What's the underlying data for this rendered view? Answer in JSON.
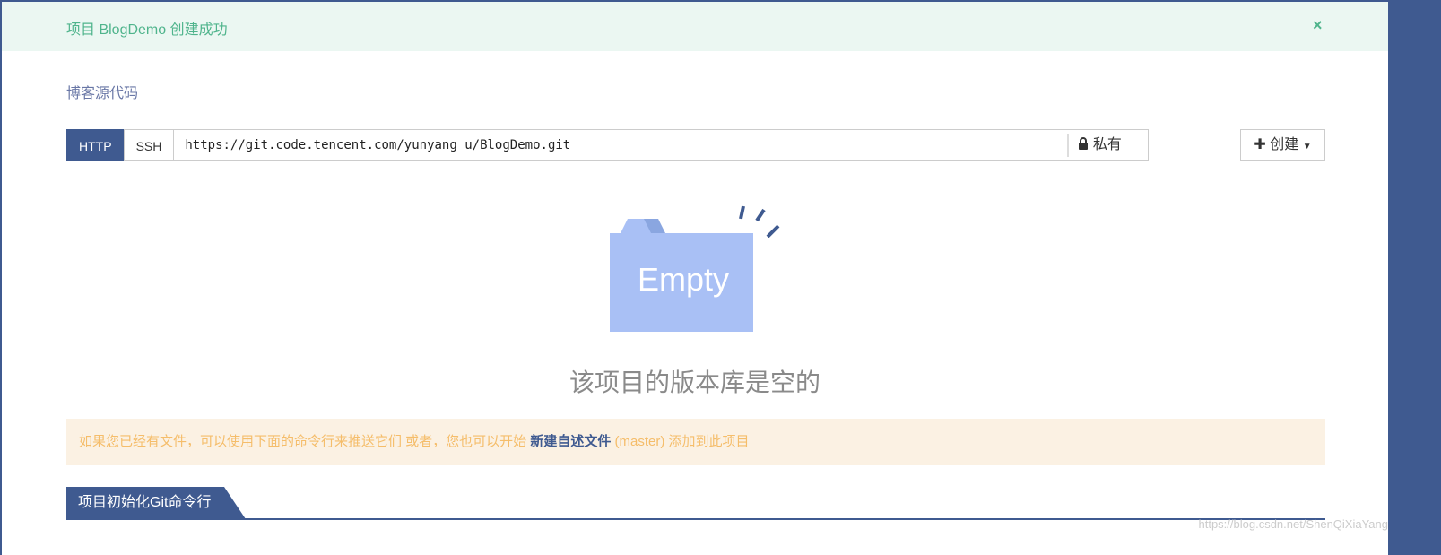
{
  "alert": {
    "message": "项目 BlogDemo 创建成功",
    "close": "×"
  },
  "repo": {
    "description": "博客源代码"
  },
  "clone": {
    "tabs": [
      "HTTP",
      "SSH"
    ],
    "active": "HTTP",
    "url": "https://git.code.tencent.com/yunyang_u/BlogDemo.git",
    "visibility": "私有",
    "create_label": "创建"
  },
  "empty": {
    "illustration_text": "Empty",
    "message": "该项目的版本库是空的"
  },
  "hint": {
    "prefix": "如果您已经有文件，可以使用下面的命令行来推送它们 或者，您也可以开始 ",
    "link": "新建自述文件",
    "suffix": " (master) 添加到此项目"
  },
  "section": {
    "title": "项目初始化Git命令行"
  },
  "watermark": "https://blog.csdn.net/ShenQiXiaYang",
  "colors": {
    "primary": "#3f5a90",
    "success": "#4fb48c",
    "warning": "#f5bd6a"
  }
}
